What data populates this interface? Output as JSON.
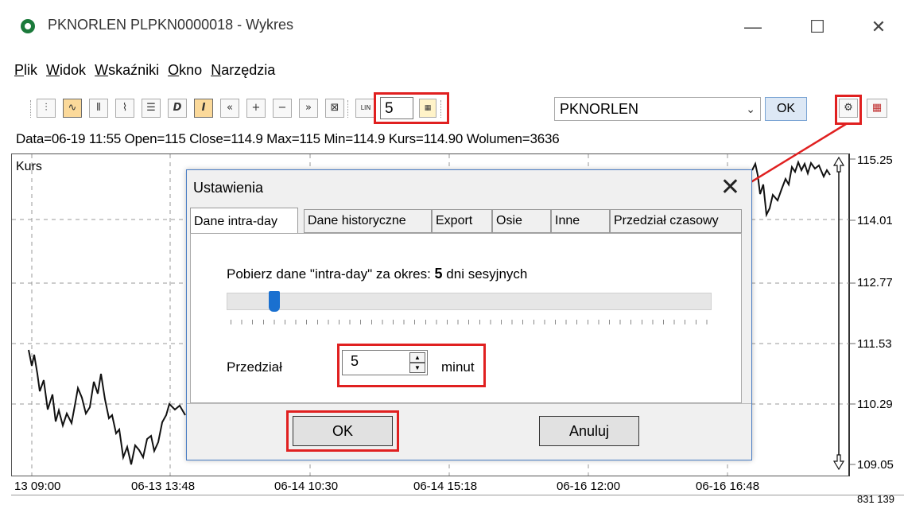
{
  "window": {
    "title": "PKNORLEN PLPKN0000018 - Wykres",
    "minimize": "—",
    "maximize": "☐",
    "close": "✕"
  },
  "menu": [
    "Plik",
    "Widok",
    "Wskaźniki",
    "Okno",
    "Narzędzia"
  ],
  "toolbar": {
    "icons": [
      "candles-icon",
      "line-chart-icon",
      "bars-icon",
      "area-chart-icon",
      "list-icon",
      "daily-icon",
      "intraday-icon",
      "scroll-left-icon",
      "zoom-in-icon",
      "zoom-out-icon",
      "scroll-right-icon",
      "fit-icon",
      "lin-scale-icon"
    ],
    "period_value": "5",
    "symbol": "PKNORLEN",
    "ok_label": "OK"
  },
  "status_line": "Data=06-19 11:55 Open=115 Close=114.9 Max=115 Min=114.9 Kurs=114.90 Wolumen=3636",
  "chart": {
    "series_label": "Kurs",
    "y_ticks": [
      "115.25",
      "114.01",
      "112.77",
      "111.53",
      "110.29",
      "109.05"
    ],
    "x_ticks": [
      "13 09:00",
      "06-13 13:48",
      "06-14 10:30",
      "06-14 15:18",
      "06-16 12:00",
      "06-16 16:48"
    ],
    "bottom_value": "831 139"
  },
  "dialog": {
    "title": "Ustawienia",
    "tabs": [
      "Dane intra-day",
      "Dane historyczne",
      "Export",
      "Osie",
      "Inne",
      "Przedział czasowy"
    ],
    "active_tab": "Dane intra-day",
    "fetch_prefix": "Pobierz dane \"intra-day\" za okres:",
    "fetch_days": "5",
    "fetch_suffix": "dni sesyjnych",
    "slider_value": 5,
    "interval_label": "Przedział",
    "interval_value": "5",
    "interval_unit": "minut",
    "ok_label": "OK",
    "cancel_label": "Anuluj"
  },
  "colors": {
    "highlight": "#e02020",
    "active_toolbar": "#fbd99a",
    "slider_thumb": "#1a70d0"
  }
}
